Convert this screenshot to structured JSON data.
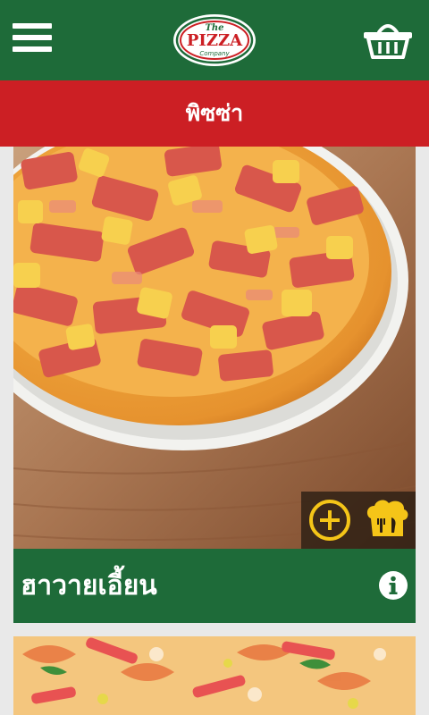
{
  "header": {
    "menu_icon": "hamburger-menu-icon",
    "logo": {
      "line1": "The",
      "line2": "PIZZA",
      "line3": "Company"
    },
    "cart_icon": "basket-icon",
    "colors": {
      "green": "#1e6b39",
      "red": "#cc1f24"
    }
  },
  "category": {
    "title": "พิซซ่า"
  },
  "products": [
    {
      "name": "ฮาวายเอี้ยน",
      "image": "hawaiian-pizza-photo",
      "add_icon": "plus-circle-icon",
      "chef_icon": "chef-hat-utensils-icon",
      "info_icon": "info-icon"
    },
    {
      "image": "seafood-pizza-photo"
    }
  ]
}
